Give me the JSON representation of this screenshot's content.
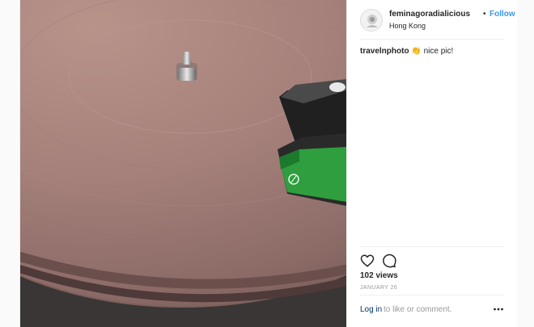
{
  "post": {
    "author": {
      "username": "feminagoradialicious",
      "separator": "•",
      "follow_label": "Follow",
      "location": "Hong Kong",
      "avatar_icon": "avatar-icon"
    },
    "comments": [
      {
        "username": "travelnphoto",
        "emoji": "👏",
        "text": "nice pic!"
      }
    ],
    "actions": {
      "like_icon": "heart-icon",
      "comment_icon": "comment-icon"
    },
    "views_label": "102 views",
    "date_label": "JANUARY 26",
    "footer": {
      "login_label": "Log in",
      "login_suffix": "to like or comment.",
      "more_icon": "more-options-icon"
    }
  },
  "colors": {
    "link_blue": "#3897f0",
    "login_blue": "#003569",
    "text_dark": "#262626",
    "muted": "#999999",
    "border": "#efefef"
  }
}
